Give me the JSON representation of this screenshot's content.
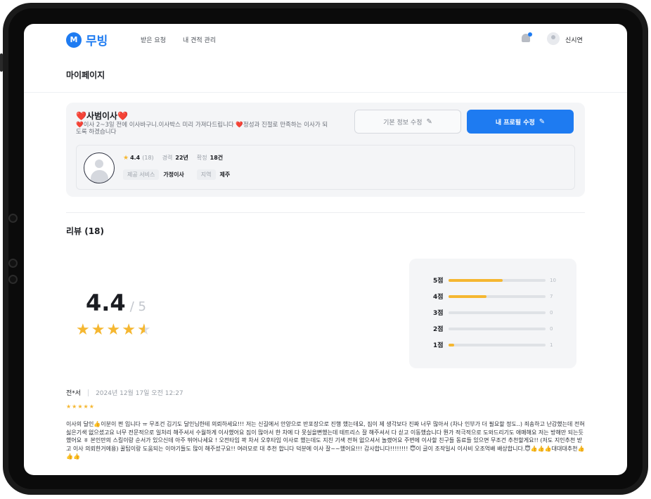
{
  "header": {
    "logo_mark": "M",
    "logo_text": "무빙",
    "nav": [
      "받은 요청",
      "내 견적 관리"
    ],
    "user_name": "신시연"
  },
  "page_title": "마이페이지",
  "profile": {
    "name": "❤️사범이사❤️",
    "description": "❤️이사 2~3일 전에 이사바구니.이사박스 미리 가져다드립니다 ❤️정성과 진절로 만족하는 이사가 되도록 하겠습니다",
    "edit_basic_label": "기본 정보 수정",
    "edit_profile_label": "내 프로필 수정",
    "rating": "4.4",
    "rating_count": "(18)",
    "career_label": "경력",
    "career_value": "22년",
    "confirmed_label": "확정",
    "confirmed_value": "18건",
    "service_label": "제공 서비스",
    "service_value": "가정이사",
    "region_label": "지역",
    "region_value": "제주"
  },
  "reviews": {
    "title": "리뷰 (18)",
    "average": "4.4",
    "max": "/ 5",
    "average_fraction": 0.88,
    "distribution": [
      {
        "label": "5점",
        "count": "10",
        "value": 10
      },
      {
        "label": "4점",
        "count": "7",
        "value": 7
      },
      {
        "label": "3점",
        "count": "0",
        "value": 0
      },
      {
        "label": "2점",
        "count": "0",
        "value": 0
      },
      {
        "label": "1점",
        "count": "1",
        "value": 1
      }
    ],
    "dist_max": 18
  },
  "review_item": {
    "author": "전*서",
    "date": "2024년 12월 17일 오전 12:27",
    "stars": 5,
    "text": "이사의 달인👍이분이 쩐 입니다 ㅠ 무조건 김기도 달인님한테 의뢰하세요!!! 저는 신길에서 안양으로 반포장으로 진행 했는데요, 짐이 제 생각보다 진짜 너무 많아서 (차나 인부가 더 필요할 정도..) 죄송하고 난감했는데 전혀 싫은기색 없으셨고요 너무 전문적으로 일처리 해주셔서 수월하게 이사했어요 짐이 많아서 한 차에 다 못실을뻔했는데 테트리스 잘 해주셔서 다 싣고 이동했습니다 뭔가 적극적으로 도와드리기도 애매해요 저는 방해만 되는듯 했어요 ㅎ 본인만의 스킬이랑 순서가 있으신데 아주 뛰어나세요 ! 오전타임 꽉 차서 오후타임 이사로 했는데도 지친 기색 전혀 없으셔서 놀랬어요 주변에 이사할 친구들 동료들 있으면 무조건 추천할게요!! (저도 지인추천 받고 이사 의뢰한거에용) 꿀팁이랑 도움되는 이야기들도 많이 해주셨구요!! 여러모로 대 추천 합니다 덕분에 이사 잘~~했어요!!! 감사합니다!!!!!!!! 😇이 글이 조작일시 이사비 오조억배 배상합니다.😇👍👍👍대대대추천👍👍👍"
  }
}
